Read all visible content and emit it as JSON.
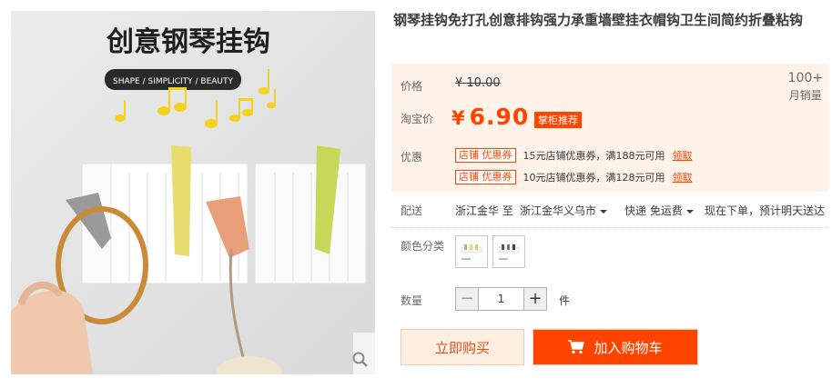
{
  "gallery": {
    "headline": "创意钢琴挂钩",
    "tagline": "SHAPE / SIMPLICITY / BEAUTY"
  },
  "product": {
    "title": "钢琴挂钩免打孔创意排钩强力承重墙壁挂衣帽钩卫生间简约折叠粘钩"
  },
  "price": {
    "original_label": "价格",
    "original_value": "¥ 10.00",
    "promo_label": "淘宝价",
    "promo_currency": "¥",
    "promo_value": "6.90",
    "promo_tag": "掌柜推荐",
    "sales_count": "100+",
    "sales_label": "月销量"
  },
  "coupons": {
    "label": "优惠",
    "items": [
      {
        "tag": "店铺  优惠券",
        "text": "15元店铺优惠券，满188元可用",
        "action": "领取"
      },
      {
        "tag": "店铺  优惠券",
        "text": "10元店铺优惠券，满128元可用",
        "action": "领取"
      }
    ]
  },
  "shipping": {
    "label": "配送",
    "from": "浙江金华 至",
    "to": "浙江金华义乌市",
    "express": "快递 免运费",
    "eta": "现在下单，预计明天送达"
  },
  "color": {
    "label": "颜色分类"
  },
  "quantity": {
    "label": "数量",
    "minus": "−",
    "value": "1",
    "plus": "+",
    "unit": "件"
  },
  "actions": {
    "buy_now": "立即购买",
    "add_to_cart": "加入购物车"
  },
  "colors": {
    "accent": "#ff4400",
    "price_bg": "#fff2e8",
    "buy_bg": "#ffeee2"
  }
}
